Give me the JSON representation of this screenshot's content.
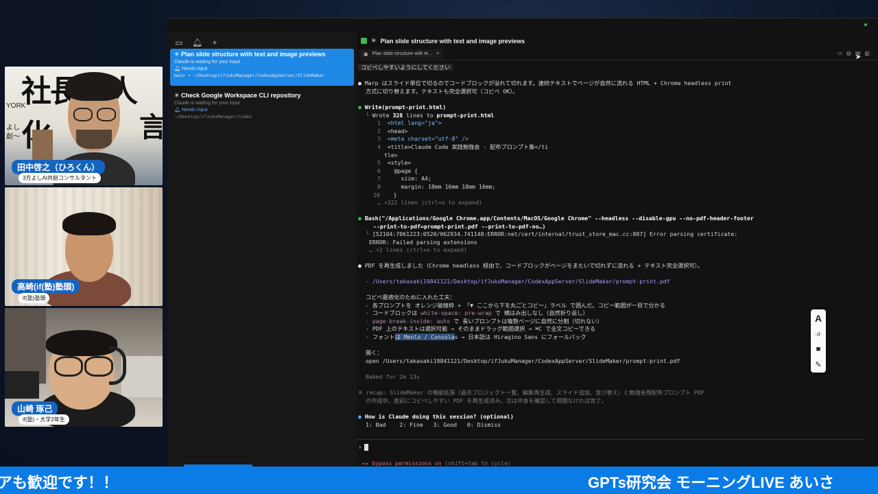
{
  "cams": [
    {
      "name": "田中啓之（ひろくん）",
      "role": "3方よしAI共創コンサルタント",
      "bg_text": "社長無人化",
      "bg_side": [
        "YORK",
        "よし",
        "創〜"
      ],
      "bg_right": "言"
    },
    {
      "name": "高崎(if(塾)塾頭)",
      "role": "if(塾)塾頭"
    },
    {
      "name": "山崎 琢己",
      "role": "if(塾)・大学2年生"
    }
  ],
  "sidebar": {
    "toolbar_icons": [
      "sidebar-toggle-icon",
      "bell-icon",
      "plus-icon"
    ],
    "tasks": [
      {
        "title": "Plan slide structure with text and image previews",
        "status": "Claude is waiting for your input",
        "needs": "Needs input",
        "path": "main • ~/Desktop/ifJukuManager/CodexAppServer/SlideMaker"
      },
      {
        "title": "Check Google Workspace CLI repository",
        "status": "Claude is waiting for your input",
        "needs": "Needs input",
        "path": "~/Desktop/ifJukuManager/Codex"
      }
    ]
  },
  "main": {
    "header_title": "Plan slide structure with text and image previews",
    "tab_label": "Plan slide structure with te...",
    "tab_close": "×",
    "terminal": {
      "l1": "コピペしやすいようにしてください",
      "l2a": "Marp はスライド単位で切るのでコードブロックが溢れて切れます。連続テキストでページが自然に流れる HTML + Chrome headless print",
      "l2b": "方式に切り替えます。テキストも完全選択可（コピペ OK）。",
      "write_call": "Write(prompt-print.html)",
      "write_result_pre": "Wrote ",
      "write_result_num": "328",
      "write_result_mid": " lines to ",
      "write_result_file": "prompt-print.html",
      "code": [
        {
          "n": "1",
          "t": "<html lang=\"ja\">"
        },
        {
          "n": "2",
          "t": "<head>"
        },
        {
          "n": "3",
          "t": "<meta charset=\"utf-8\" />"
        },
        {
          "n": "4",
          "t": "<title>Claude Code 実践勉強会 - 配布プロンプト集</ti"
        },
        {
          "n": "",
          "t": "tle>"
        },
        {
          "n": "5",
          "t": "<style>"
        },
        {
          "n": "6",
          "t": "  @page {"
        },
        {
          "n": "7",
          "t": "    size: A4;"
        },
        {
          "n": "8",
          "t": "    margin: 18mm 16mm 18mm 16mm;"
        },
        {
          "n": "10",
          "t": "  }"
        }
      ],
      "more1": "+322 lines (ctrl+o to expand)",
      "bash_a": "Bash(\"/Applications/Google Chrome.app/Contents/MacOS/Google Chrome\" --headless --disable-gpu --no-pdf-header-footer",
      "bash_b": "--print-to-pdf=prompt-print.pdf --print-to-pdf-no…)",
      "err1": "[52104:7061223:0520/062934.741148:ERROR:net/cert/internal/trust_store_mac.cc:807] Error parsing certificate:",
      "err2": "ERROR: Failed parsing extensions",
      "more2": "+2 lines (ctrl+o to expand)",
      "pdf_done": "PDF を再生成しました（Chrome headless 経由で、コードブロックがページをまたいで切れずに流れる + テキスト完全選択可）。",
      "pdf_path": "- /Users/takasaki19841121/Desktop/ifJukuManager/CodexAppServer/SlideMaker/prompt-print.pdf",
      "tips_title": "コピペ最適化のために入れた工夫：",
      "tip1": "- 各プロンプトを オレンジ破線枠 + 「▼ ここから下を丸ごとコピー」ラベル で囲んだ。コピー範囲が一目で分かる",
      "tip2_pre": "- コードブロックは ",
      "tip2_code": "white-space: pre-wrap",
      "tip2_post": " で 横はみ出しなし（自然折り返し）",
      "tip3_code": "- page-break-inside: auto",
      "tip3_post": " で 長いプロンプトは複数ページに自然に分割（切れない）",
      "tip4": "- PDF 上のテキストは選択可能 → そのままドラッグ範囲選択 → ⌘C で全文コピーできる",
      "tip5_pre": "- フォント",
      "tip5_hl": "は Menlo / Consola",
      "tip5_post": "s → 日本語は Hiragino Sans にフォールバック",
      "open_label": "開く：",
      "open_cmd": "open /Users/takasaki19841121/Desktop/ifJukuManager/CodexAppServer/SlideMaker/prompt-print.pdf",
      "baked": "Baked for 2m 13s",
      "recap_a": "recap: SlideMaker の機能拡張（過去プロジェクト一覧、編集再生成、スライド追加、並び替え）と勉強会用配布プロンプト PDF",
      "recap_b": "の作成中。直前にコピペしやすい PDF を再生成済み。次は中身を確認して問題なければ完了。",
      "survey_q": "How is Claude doing this session? (optional)",
      "survey_opts": "1: Bad    2: Fine   3: Good   0: Dismiss"
    },
    "prompt_symbol": "›",
    "bypass_pre": "▸▸ bypass permissions on",
    "bypass_post": " (shift+tab to cycle)"
  },
  "float_tools": [
    "pen-icon",
    "dots-icon",
    "stop-icon",
    "edit-icon"
  ],
  "ticker": {
    "left": "アも歓迎です！！",
    "right": "GPTs研究会 モーニングLIVE あいさ"
  }
}
